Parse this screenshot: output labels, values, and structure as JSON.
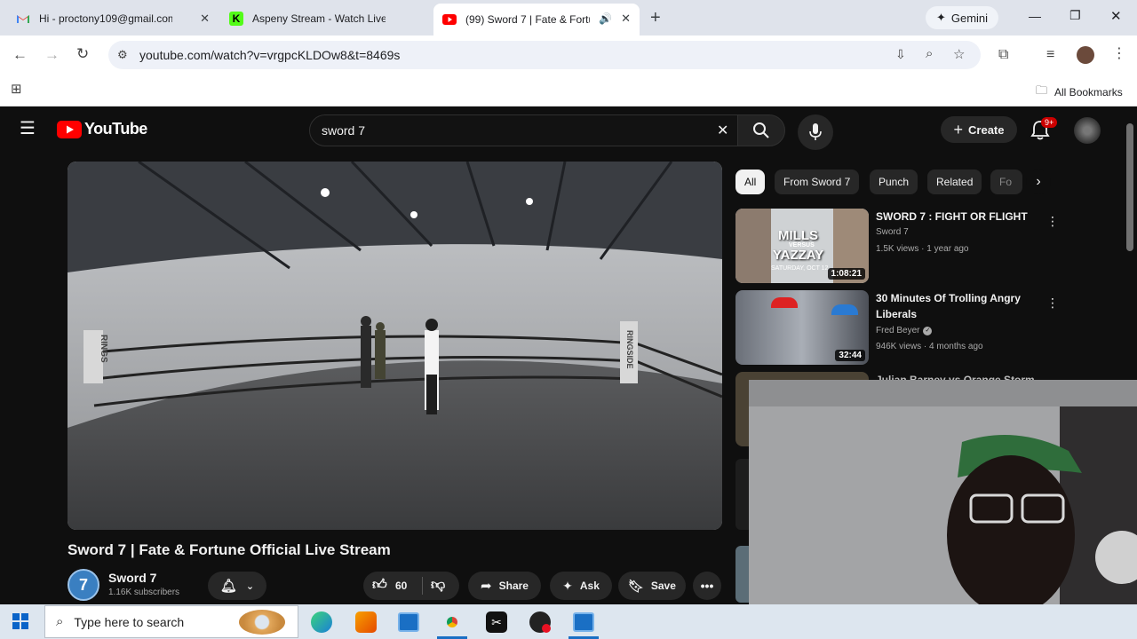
{
  "browser": {
    "tabs": [
      {
        "title": "Hi - proctony109@gmail.com -",
        "favicon": "gmail-icon"
      },
      {
        "title": "Aspeny Stream - Watch Live on",
        "favicon": "kick-icon"
      },
      {
        "title": "(99) Sword 7 | Fate & Fortun",
        "favicon": "youtube-icon",
        "active": true
      }
    ],
    "gemini_label": "Gemini",
    "url": "youtube.com/watch?v=vrgpcKLDOw8&t=8469s",
    "bookmarks_label": "All Bookmarks"
  },
  "youtube": {
    "logo_text": "YouTube",
    "search_value": "sword 7",
    "create_label": "Create",
    "notification_badge": "9+",
    "chips": [
      "All",
      "From Sword 7",
      "Punch",
      "Related",
      "Fo"
    ],
    "video": {
      "title": "Sword 7 | Fate & Fortune Official Live Stream",
      "ring_text_left": "RINGS",
      "ring_text_right": "RINGSIDE"
    },
    "channel": {
      "name": "Sword 7",
      "subscribers": "1.16K subscribers",
      "avatar_text": "7"
    },
    "actions": {
      "likes": "60",
      "share": "Share",
      "ask": "Ask",
      "save": "Save"
    },
    "recommendations": [
      {
        "title": "SWORD 7 : FIGHT OR FLIGHT",
        "channel": "Sword 7",
        "meta": "1.5K views · 1 year ago",
        "duration": "1:08:21",
        "thumb_text_top": "MILLS",
        "thumb_text_mid": "VERSUS",
        "thumb_text_bottom": "YAZZAY",
        "thumb_caption": "SATURDAY, OCT 12"
      },
      {
        "title": "30 Minutes Of Trolling Angry Liberals",
        "channel": "Fred Beyer",
        "meta": "946K views · 4 months ago",
        "duration": "32:44",
        "verified": true
      },
      {
        "title": "Julian Barney vs Orange Storm",
        "channel": "",
        "meta": ""
      }
    ]
  },
  "taskbar": {
    "search_placeholder": "Type here to search"
  },
  "colors": {
    "youtube_red": "#ff0000",
    "badge_red": "#cc0000",
    "tabbar_bg": "#dfe3eb",
    "yt_bg": "#0f0f0f",
    "chip_bg": "#272727"
  }
}
